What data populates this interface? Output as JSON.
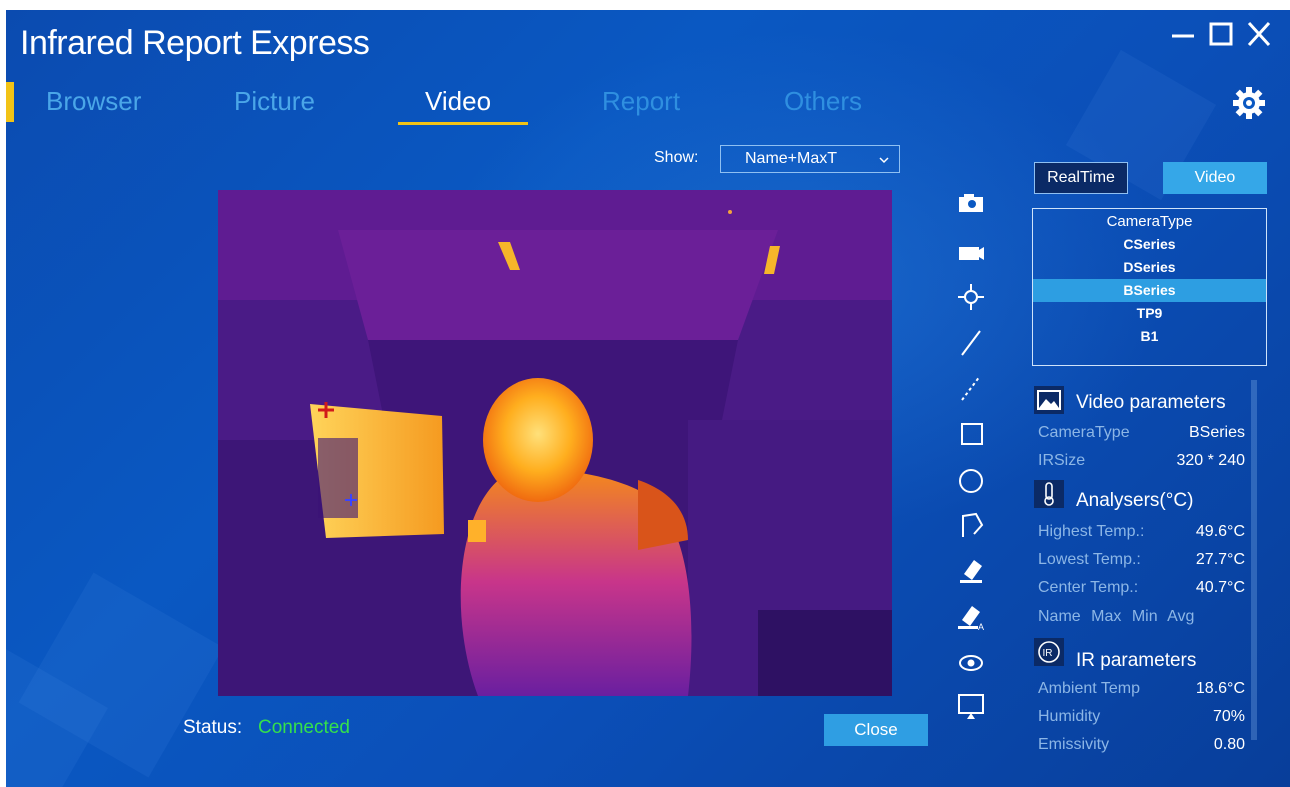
{
  "app": {
    "title": "Infrared Report Express"
  },
  "window_controls": {
    "minimize": "minimize-icon",
    "maximize": "maximize-icon",
    "close": "close-icon",
    "settings": "gear-icon"
  },
  "nav": {
    "tabs": [
      {
        "label": "Browser",
        "color": "#4aa6e8"
      },
      {
        "label": "Picture",
        "color": "#4aa6e8"
      },
      {
        "label": "Video",
        "color": "#ffffff",
        "active": true
      },
      {
        "label": "Report",
        "color": "#2f8fe0"
      },
      {
        "label": "Others",
        "color": "#2f8fe0"
      }
    ]
  },
  "show": {
    "label": "Show:",
    "value": "Name+MaxT"
  },
  "viewer": {
    "description_icon": "thermal-video-frame"
  },
  "status": {
    "label": "Status:",
    "value": "Connected",
    "value_color": "#34e04c"
  },
  "close_label": "Close",
  "toolbar": [
    {
      "name": "camera-icon"
    },
    {
      "name": "video-camera-icon"
    },
    {
      "name": "spot-point-icon"
    },
    {
      "name": "line-icon"
    },
    {
      "name": "dashed-line-icon"
    },
    {
      "name": "rectangle-icon"
    },
    {
      "name": "circle-icon"
    },
    {
      "name": "polygon-icon"
    },
    {
      "name": "eraser-icon"
    },
    {
      "name": "eraser-all-icon"
    },
    {
      "name": "eye-icon"
    },
    {
      "name": "monitor-icon"
    }
  ],
  "mode": {
    "realtime": "RealTime",
    "video": "Video"
  },
  "camera_list": {
    "header": "CameraType",
    "items": [
      "CSeries",
      "DSeries",
      "BSeries",
      "TP9",
      "B1"
    ],
    "selected": "BSeries"
  },
  "video_params": {
    "title": "Video parameters",
    "rows": [
      {
        "label": "CameraType",
        "value": "BSeries"
      },
      {
        "label": "IRSize",
        "value": "320 * 240"
      }
    ]
  },
  "analysers": {
    "title": "Analysers(°C)",
    "rows": [
      {
        "label": "Highest Temp.:",
        "value": "49.6°C"
      },
      {
        "label": "Lowest Temp.:",
        "value": "27.7°C"
      },
      {
        "label": "Center Temp.:",
        "value": "40.7°C"
      }
    ],
    "columns": [
      "Name",
      "Max",
      "Min",
      "Avg"
    ]
  },
  "ir_params": {
    "title": "IR parameters",
    "rows": [
      {
        "label": "Ambient Temp",
        "value": "18.6°C"
      },
      {
        "label": "Humidity",
        "value": "70%"
      },
      {
        "label": "Emissivity",
        "value": "0.80"
      }
    ]
  },
  "colors": {
    "background": "#0a58c2",
    "accent": "#f2c316",
    "button": "#2f9ee3",
    "selected_row": "#2d9ee2"
  }
}
